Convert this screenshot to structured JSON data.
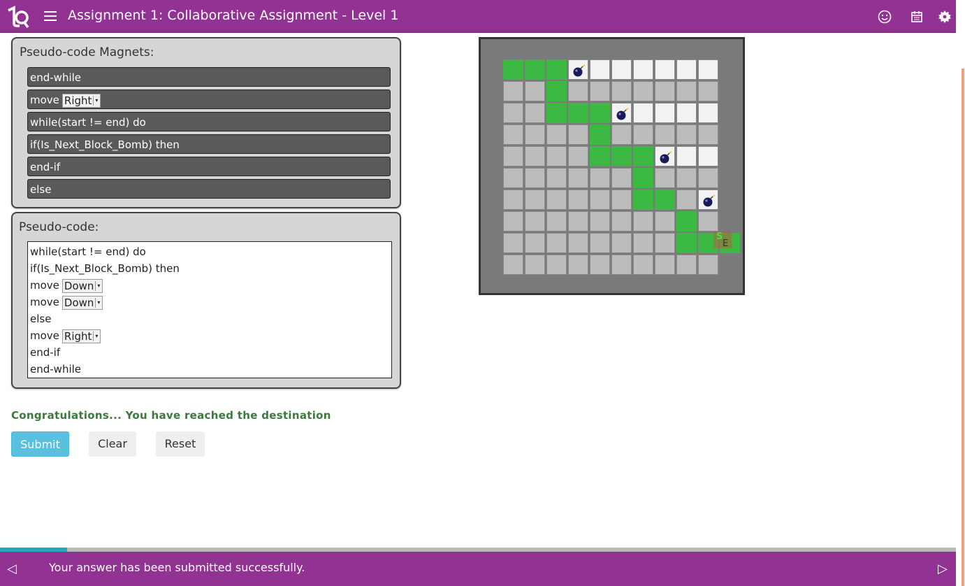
{
  "header": {
    "title": "Assignment 1: Collaborative Assignment - Level 1",
    "bg": "#923393"
  },
  "magnets": {
    "title": "Pseudo-code Magnets:",
    "items": [
      {
        "text": "end-while",
        "select": null
      },
      {
        "text": "move",
        "select": "Right"
      },
      {
        "text": "while(start != end) do",
        "select": null
      },
      {
        "text": "if(Is_Next_Block_Bomb) then",
        "select": null
      },
      {
        "text": "end-if",
        "select": null
      },
      {
        "text": "else",
        "select": null
      }
    ]
  },
  "code": {
    "title": "Pseudo-code:",
    "lines": [
      {
        "text": "while(start != end) do",
        "select": null
      },
      {
        "text": "if(Is_Next_Block_Bomb) then",
        "select": null
      },
      {
        "text": "move",
        "select": "Down"
      },
      {
        "text": "move",
        "select": "Down"
      },
      {
        "text": "else",
        "select": null
      },
      {
        "text": "move",
        "select": "Right"
      },
      {
        "text": "end-if",
        "select": null
      },
      {
        "text": "end-while",
        "select": null
      }
    ]
  },
  "status": {
    "message": "Congratulations... You have reached the destination",
    "color": "#3a7a3a"
  },
  "buttons": {
    "submit": "Submit",
    "clear": "Clear",
    "reset": "Reset"
  },
  "grid": {
    "rows": 10,
    "cols": 10,
    "cells": [
      "GGGBWWWWWW",
      "..G.......",
      "..GGGBWWWW",
      "....G.....",
      "....GGGBWW",
      "......G...",
      "......GG.B",
      "........G.",
      "........GG",
      ".........."
    ],
    "start_label": "S",
    "end_label": "E",
    "colors": {
      "green": "#3cb943",
      "gray": "#bcbcbc",
      "white": "#f2f2f2",
      "bomb": "#1a1a5a"
    }
  },
  "footer": {
    "message": "Your answer has been submitted successfully.",
    "progress": 0.07
  }
}
